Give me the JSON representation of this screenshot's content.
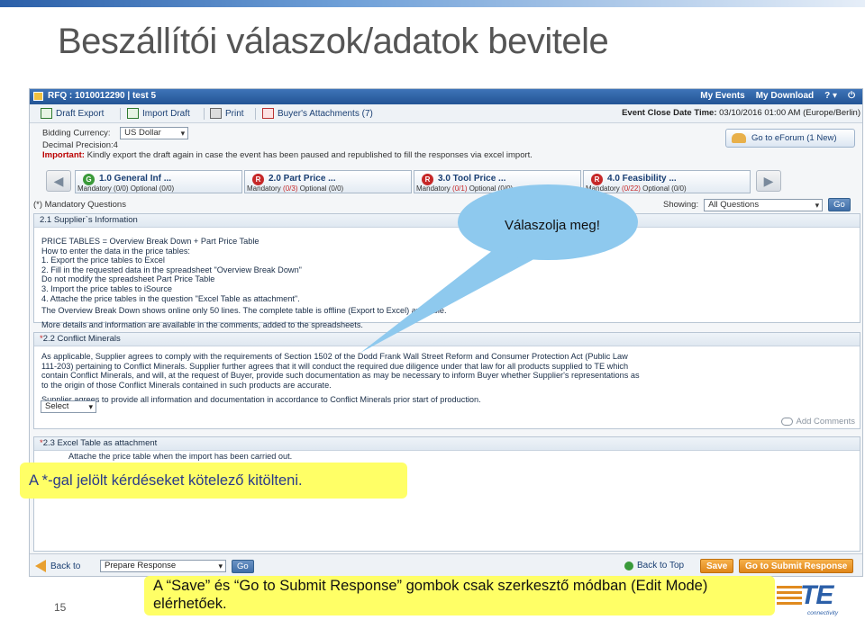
{
  "slide": {
    "title": "Beszállítói válaszok/adatok bevitele",
    "page_number": "15"
  },
  "header": {
    "rfq_title": "RFQ : 1010012290 | test 5",
    "links": [
      "My Events",
      "My Download",
      "? ▾"
    ],
    "power": "⏻"
  },
  "toolbar": {
    "draft_export": "Draft Export",
    "import_draft": "Import Draft",
    "print": "Print",
    "buyers_attachments": "Buyer's Attachments (7)",
    "event_close_label": "Event Close Date Time:",
    "event_close_value": "03/10/2016 01:00 AM  (Europe/Berlin)"
  },
  "meta": {
    "bidding_currency_label": "Bidding Currency:",
    "bidding_currency_value": "US Dollar",
    "decimal_precision": "Decimal Precision:4",
    "important_label": "Important:",
    "important_text": "Kindly export the draft again in case the event has been paused and republished to fill the responses via excel import.",
    "eforum": "Go to eForum (1 New)"
  },
  "sections": [
    {
      "badge": "G",
      "color": "g",
      "title": "1.0 General Inf ...",
      "mandatory_prefix": "Mandatory ",
      "mandatory": "(0/0)",
      "optional": " Optional (0/0)"
    },
    {
      "badge": "R",
      "color": "r",
      "title": "2.0 Part Price ...",
      "mandatory_prefix": "Mandatory ",
      "mandatory": "(0/3)",
      "optional": " Optional (0/0)"
    },
    {
      "badge": "R",
      "color": "r",
      "title": "3.0 Tool Price ...",
      "mandatory_prefix": "Mandatory ",
      "mandatory": "(0/1)",
      "optional": " Optional (0/0)"
    },
    {
      "badge": "R",
      "color": "r",
      "title": "4.0 Feasibility ...",
      "mandatory_prefix": "Mandatory ",
      "mandatory": "(0/22)",
      "optional": " Optional (0/0)"
    }
  ],
  "filter": {
    "mandatory_questions": "(*) Mandatory Questions",
    "showing_label": "Showing:",
    "showing_value": "All Questions",
    "go": "Go"
  },
  "q1": {
    "header": "2.1 Supplier`s Information",
    "lines": [
      "PRICE TABLES = Overview Break Down + Part Price Table",
      "How to enter the data in the price tables:",
      "1. Export the price tables to Excel",
      "2. Fill in the requested data in the spreadsheet \"Overview Break Down\"",
      "Do not modify the spreadsheet Part Price Table",
      "3. Import the price tables to iSource",
      "4. Attache the price tables in the question \"Excel Table as attachment\".",
      "The Overview Break Down shows online only 50 lines. The complete table is offline (Export to Excel) available.",
      "More details and information are available in the comments, added to the spreadsheets."
    ]
  },
  "q2": {
    "star": "*",
    "header": "2.2 Conflict Minerals",
    "lines": [
      "As applicable, Supplier agrees to comply with the requirements of Section 1502 of the Dodd Frank Wall Street Reform and Consumer Protection Act (Public Law",
      "111-203) pertaining to Conflict Minerals. Supplier further agrees that it will conduct the required due diligence under that law for all products supplied to TE which",
      "contain Conflict Minerals, and will, at the request of Buyer, provide such documentation as may be necessary to inform Buyer whether Supplier's representations as",
      "to the origin of those Conflict Minerals contained in such products are accurate.",
      "Supplier agrees to provide all information and documentation in accordance to Conflict Minerals prior start of production."
    ],
    "select": "Select",
    "add_comments": "Add Comments"
  },
  "q3": {
    "star": "*",
    "header": "2.3 Excel Table as attachment",
    "line": "Attache the price table when the import has been carried out."
  },
  "bottom": {
    "back_to": "Back to",
    "prepare_response": "Prepare Response",
    "go": "Go",
    "back_to_top": "Back to Top",
    "save": "Save",
    "submit": "Go to Submit Response"
  },
  "annotations": {
    "callout": "Válaszolja meg!",
    "mandatory_note": "A *-gal jelölt kérdéseket kötelező kitölteni.",
    "bottom_note": "A “Save” és “Go to Submit Response” gombok csak szerkesztő módban (Edit Mode) elérhetőek."
  },
  "logo": {
    "text": "TE",
    "sub": "connectivity"
  },
  "colors": {
    "header_blue": "#235495",
    "orange_button": "#e0861a",
    "callout_blue": "#8ec9ee",
    "note_yellow": "#ffff66"
  }
}
